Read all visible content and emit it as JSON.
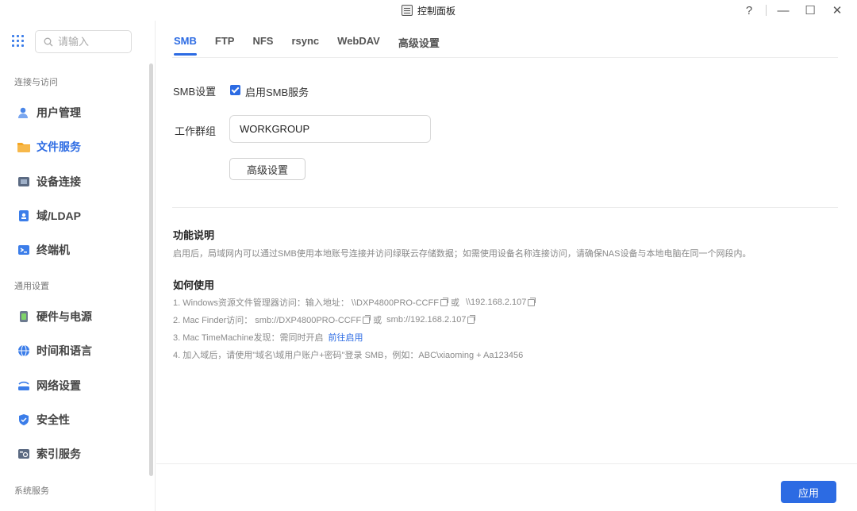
{
  "window": {
    "title": "控制面板",
    "help": "?",
    "minimize": "—",
    "maximize": "☐",
    "close": "✕"
  },
  "sidebar": {
    "search_placeholder": "请输入",
    "sections": [
      {
        "label": "连接与访问"
      },
      {
        "label": "通用设置"
      },
      {
        "label": "系统服务"
      }
    ],
    "items": [
      {
        "label": "用户管理",
        "icon": "user-icon",
        "active": false
      },
      {
        "label": "文件服务",
        "icon": "folder-icon",
        "active": true
      },
      {
        "label": "设备连接",
        "icon": "device-icon",
        "active": false
      },
      {
        "label": "域/LDAP",
        "icon": "domain-icon",
        "active": false
      },
      {
        "label": "终端机",
        "icon": "terminal-icon",
        "active": false
      },
      {
        "label": "硬件与电源",
        "icon": "hardware-icon",
        "active": false
      },
      {
        "label": "时间和语言",
        "icon": "globe-icon",
        "active": false
      },
      {
        "label": "网络设置",
        "icon": "network-icon",
        "active": false
      },
      {
        "label": "安全性",
        "icon": "shield-icon",
        "active": false
      },
      {
        "label": "索引服务",
        "icon": "index-icon",
        "active": false
      }
    ]
  },
  "tabs": [
    {
      "label": "SMB",
      "active": true
    },
    {
      "label": "FTP",
      "active": false
    },
    {
      "label": "NFS",
      "active": false
    },
    {
      "label": "rsync",
      "active": false
    },
    {
      "label": "WebDAV",
      "active": false
    },
    {
      "label": "高级设置",
      "active": false
    }
  ],
  "smb": {
    "settings_label": "SMB设置",
    "enable_label": "启用SMB服务",
    "enabled": true,
    "workgroup_label": "工作群组",
    "workgroup_value": "WORKGROUP",
    "advanced_button": "高级设置"
  },
  "info": {
    "title": "功能说明",
    "text": "启用后，局域网内可以通过SMB使用本地账号连接并访问绿联云存储数据；如需使用设备名称连接访问，请确保NAS设备与本地电脑在同一个网段内。"
  },
  "howto": {
    "title": "如何使用",
    "step1_prefix": "1. Windows资源文件管理器访问：输入地址：  \\\\DXP4800PRO-CCFF",
    "step1_or": " 或 ",
    "step1_ip": "\\\\192.168.2.107",
    "step2_prefix": "2. Mac Finder访问：  smb://DXP4800PRO-CCFF",
    "step2_or": " 或 ",
    "step2_ip": "smb://192.168.2.107",
    "step3_text": "3. Mac TimeMachine发现：需同时开启",
    "step3_link": "前往启用",
    "step4_text": "4. 加入域后，请使用\"域名\\域用户账户+密码\"登录 SMB，例如：ABC\\xiaoming + Aa123456"
  },
  "footer": {
    "apply_label": "应用"
  },
  "colors": {
    "accent": "#2c6be3"
  }
}
